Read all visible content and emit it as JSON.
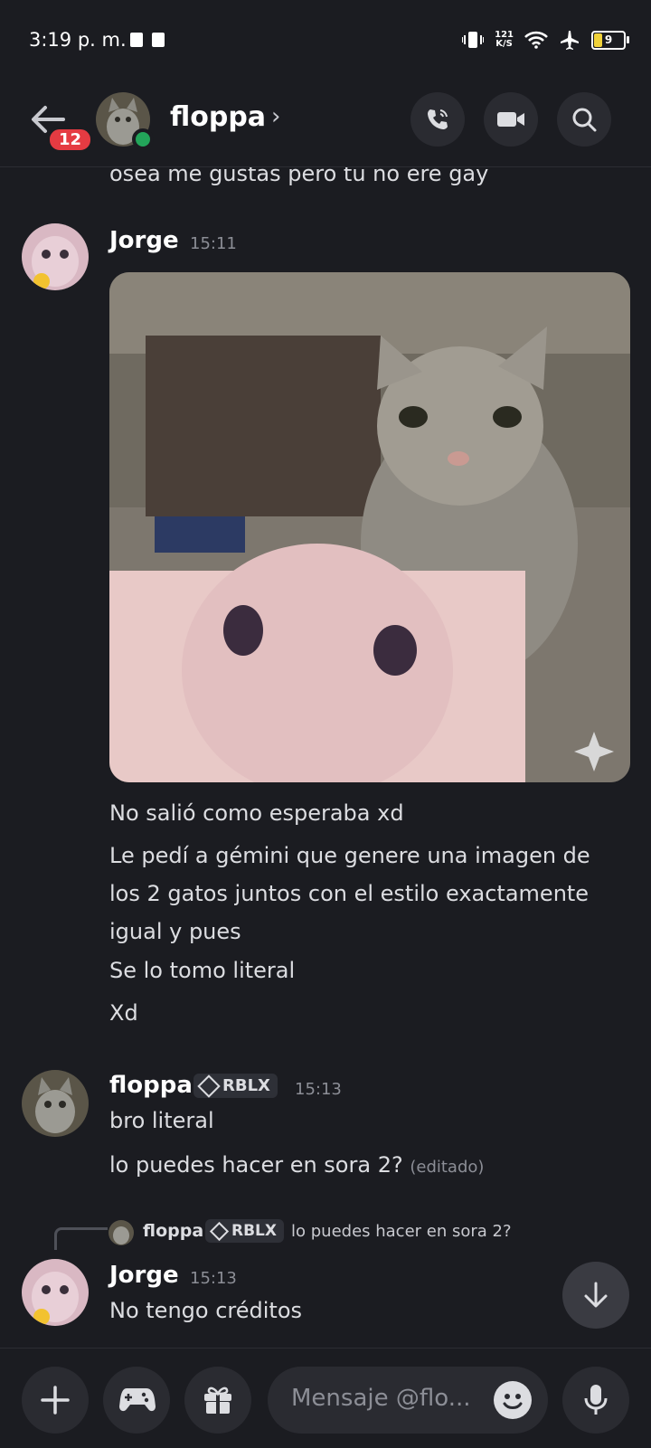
{
  "status_bar": {
    "time": "3:19 p. m.",
    "net_speed_value": "121",
    "net_speed_unit": "K/S",
    "battery_level": "9"
  },
  "header": {
    "notification_count": "12",
    "contact_name": "floppa",
    "chevron": "›"
  },
  "messages": {
    "partial_top": "osea me gustas pero tu no ere gay",
    "group1": {
      "author": "Jorge",
      "time": "15:11",
      "lines": [
        "No salió como esperaba xd",
        "Le pedí a gémini que genere una imagen de",
        "los 2 gatos juntos con el estilo exactamente",
        "igual y pues",
        "Se lo tomo literal",
        "Xd"
      ]
    },
    "group2": {
      "author": "floppa",
      "tag": "RBLX",
      "time": "15:13",
      "line1": "bro literal",
      "line2": "lo puedes hacer en sora 2?",
      "edited": "(editado)"
    },
    "reply": {
      "author": "floppa",
      "tag": "RBLX",
      "quote": "lo puedes hacer en sora 2?"
    },
    "group3": {
      "author": "Jorge",
      "time": "15:13",
      "line1": "No tengo créditos"
    }
  },
  "composer": {
    "placeholder": "Mensaje @flo..."
  },
  "colors": {
    "background": "#1b1c21",
    "badge": "#e53b42",
    "online": "#23a55a",
    "button_bg": "#2a2b31"
  }
}
